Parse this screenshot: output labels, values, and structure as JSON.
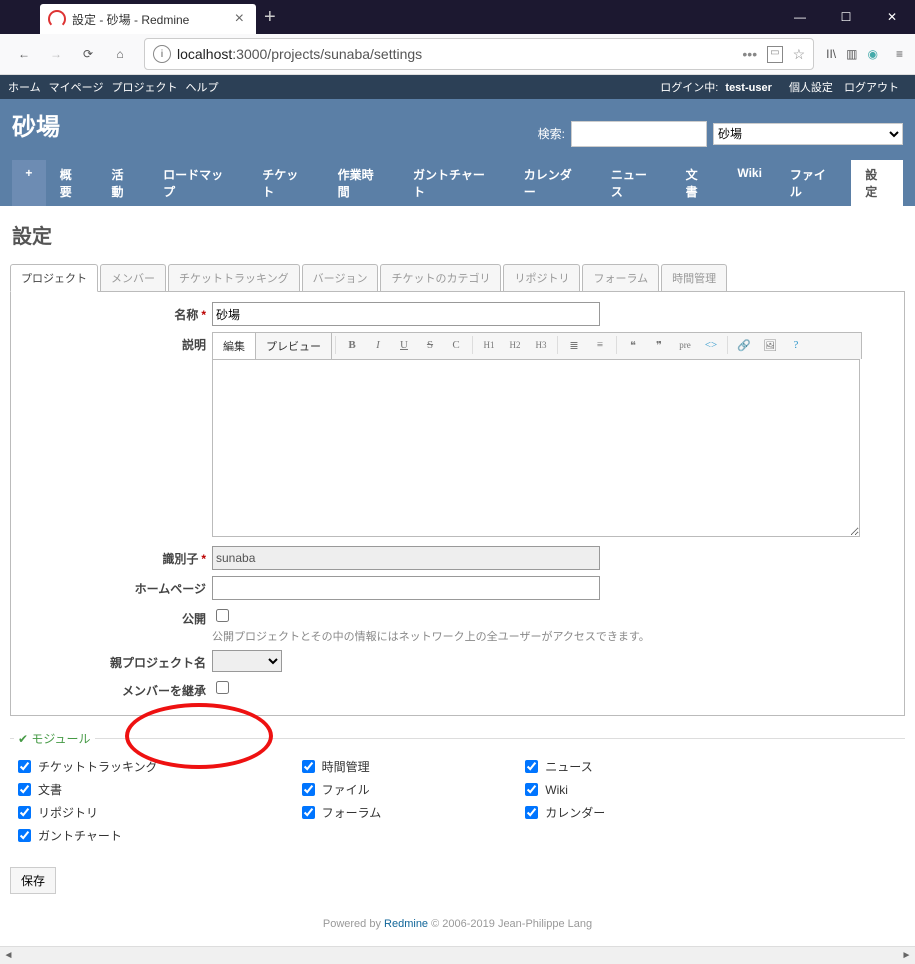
{
  "browser": {
    "tab_title": "設定 - 砂場 - Redmine",
    "url_prefix": "localhost",
    "url_path": ":3000/projects/sunaba/settings"
  },
  "topmenu": {
    "home": "ホーム",
    "mypage": "マイページ",
    "projects": "プロジェクト",
    "help": "ヘルプ",
    "loggedin_label": "ログイン中:",
    "user": "test-user",
    "myaccount": "個人設定",
    "logout": "ログアウト"
  },
  "header": {
    "title": "砂場",
    "search_label": "検索:",
    "search_value": "",
    "project_select": "砂場"
  },
  "mainmenu": {
    "plus": "+",
    "overview": "概要",
    "activity": "活動",
    "roadmap": "ロードマップ",
    "issues": "チケット",
    "time": "作業時間",
    "gantt": "ガントチャート",
    "calendar": "カレンダー",
    "news": "ニュース",
    "documents": "文書",
    "wiki": "Wiki",
    "files": "ファイル",
    "settings": "設定"
  },
  "page_title": "設定",
  "tabs": {
    "project": "プロジェクト",
    "members": "メンバー",
    "tracking": "チケットトラッキング",
    "versions": "バージョン",
    "categories": "チケットのカテゴリ",
    "repos": "リポジトリ",
    "forums": "フォーラム",
    "timemgmt": "時間管理"
  },
  "form": {
    "name_label": "名称",
    "name_value": "砂場",
    "desc_label": "説明",
    "edit_tab": "編集",
    "preview_tab": "プレビュー",
    "desc_value": "",
    "ident_label": "識別子",
    "ident_value": "sunaba",
    "homepage_label": "ホームページ",
    "homepage_value": "",
    "public_label": "公開",
    "public_hint": "公開プロジェクトとその中の情報にはネットワーク上の全ユーザーがアクセスできます。",
    "parent_label": "親プロジェクト名",
    "parent_value": "",
    "inherit_label": "メンバーを継承"
  },
  "toolbar_buttons": {
    "bold": "B",
    "italic": "I",
    "underline": "U",
    "strike": "S",
    "code": "C",
    "h1": "H1",
    "h2": "H2",
    "h3": "H3",
    "pre": "pre"
  },
  "modules": {
    "legend": "モジュール",
    "col1": [
      "チケットトラッキング",
      "文書",
      "リポジトリ",
      "ガントチャート"
    ],
    "col2": [
      "時間管理",
      "ファイル",
      "フォーラム"
    ],
    "col3": [
      "ニュース",
      "Wiki",
      "カレンダー"
    ]
  },
  "save": "保存",
  "footer": {
    "prefix": "Powered by ",
    "link": "Redmine",
    "suffix": " © 2006-2019 Jean-Philippe Lang"
  }
}
